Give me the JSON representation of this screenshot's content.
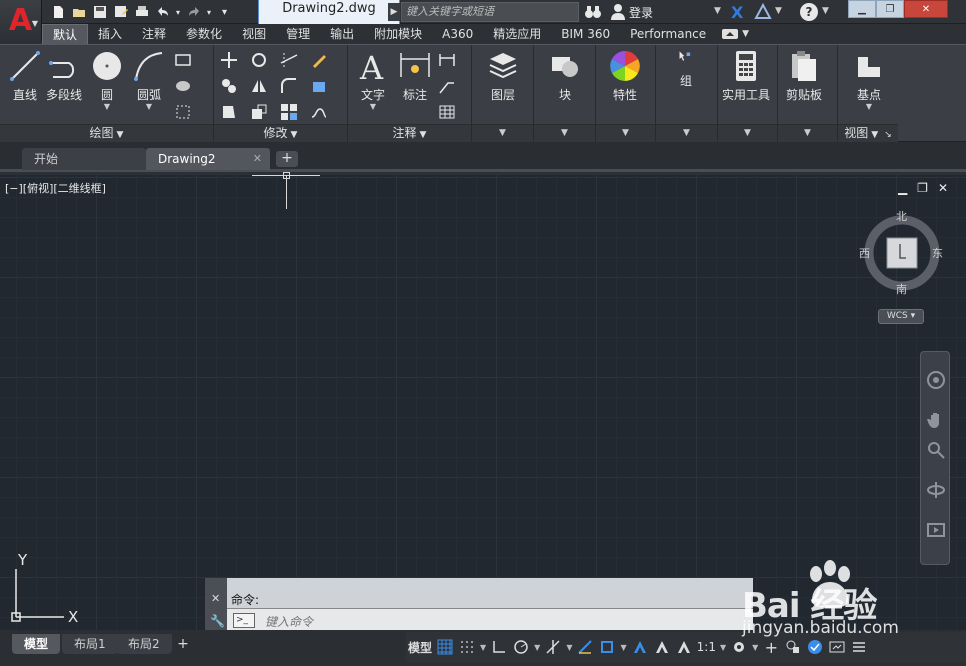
{
  "titlebar": {
    "app_logo_letter": "A",
    "document_title": "Drawing2.dwg",
    "search_placeholder": "键入关键字或短语",
    "login_label": "登录",
    "quick_access_icons": [
      "new-icon",
      "open-icon",
      "save-icon",
      "save-as-icon",
      "print-icon",
      "undo-icon",
      "redo-icon",
      "customize-icon"
    ],
    "window_controls": [
      "minimize",
      "restore",
      "close"
    ]
  },
  "ribbon_tabs": [
    "默认",
    "插入",
    "注释",
    "参数化",
    "视图",
    "管理",
    "输出",
    "附加模块",
    "A360",
    "精选应用",
    "BIM 360",
    "Performance"
  ],
  "ribbon_panels": {
    "draw": {
      "title": "绘图",
      "buttons": [
        "直线",
        "多段线",
        "圆",
        "圆弧"
      ]
    },
    "modify": {
      "title": "修改"
    },
    "annotation": {
      "title": "注释",
      "buttons": [
        "文字",
        "标注"
      ]
    },
    "layers": {
      "button": "图层"
    },
    "block": {
      "button": "块"
    },
    "properties": {
      "button": "特性"
    },
    "groups": {
      "button": "组"
    },
    "utilities": {
      "button": "实用工具"
    },
    "clipboard": {
      "button": "剪贴板"
    },
    "view": {
      "title": "视图",
      "button": "基点"
    }
  },
  "doc_tabs": [
    {
      "label": "开始"
    },
    {
      "label": "Drawing2"
    }
  ],
  "canvas": {
    "viewport_label": "[−][俯视][二维线框]",
    "viewcube": {
      "north": "北",
      "south": "南",
      "east": "东",
      "west": "西",
      "wcs": "WCS"
    },
    "ucs": {
      "x": "X",
      "y": "Y"
    }
  },
  "command": {
    "history": "命令:",
    "input_placeholder": "键入命令"
  },
  "layout_tabs": [
    "模型",
    "布局1",
    "布局2"
  ],
  "statusbar": {
    "model_label": "模型",
    "scale_label": "1:1"
  },
  "watermark": {
    "brand": "Bai 经验",
    "url": "jingyan.baidu.com"
  },
  "colors": {
    "accent_blue": "#3a8de8",
    "logo_red": "#e0242a",
    "canvas_bg": "#212830"
  }
}
